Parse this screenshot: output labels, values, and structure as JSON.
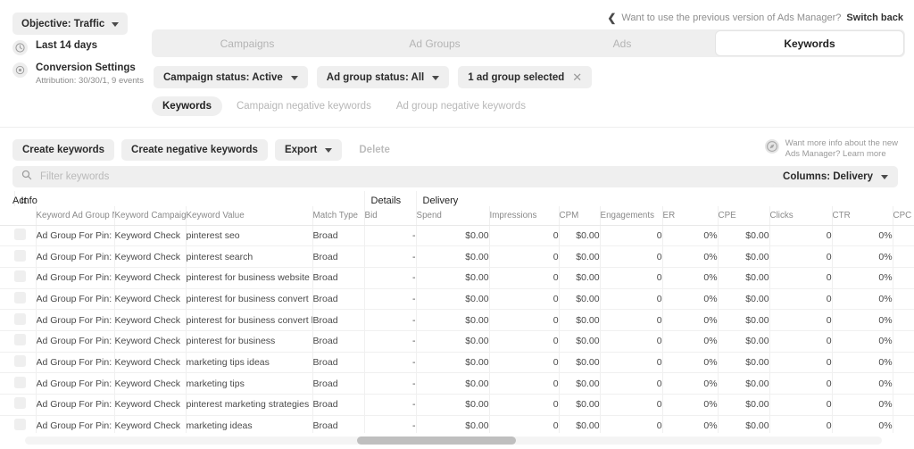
{
  "banner": {
    "back_icon": "chevron-left-icon",
    "text": "Want to use the previous version of Ads Manager?",
    "action": "Switch back"
  },
  "left_rail": {
    "objective": {
      "label": "Objective: Traffic",
      "chevron": "chevron-down-icon"
    },
    "date_range": {
      "icon": "clock-icon",
      "label": "Last 14 days"
    },
    "conversion": {
      "icon": "gear-icon",
      "label": "Conversion Settings",
      "sub": "Attribution: 30/30/1, 9 events"
    }
  },
  "tabs": [
    {
      "label": "Campaigns",
      "active": false
    },
    {
      "label": "Ad Groups",
      "active": false
    },
    {
      "label": "Ads",
      "active": false
    },
    {
      "label": "Keywords",
      "active": true
    }
  ],
  "filters": [
    {
      "label": "Campaign status: Active",
      "type": "dropdown"
    },
    {
      "label": "Ad group status: All",
      "type": "dropdown"
    },
    {
      "label": "1 ad group selected",
      "type": "removable"
    }
  ],
  "subtabs": [
    {
      "label": "Keywords",
      "active": true
    },
    {
      "label": "Campaign negative keywords",
      "active": false
    },
    {
      "label": "Ad group negative keywords",
      "active": false
    }
  ],
  "toolbar": {
    "create_keywords": "Create keywords",
    "create_negative_keywords": "Create negative keywords",
    "export": "Export",
    "delete": "Delete"
  },
  "info_note": {
    "icon": "compass-icon",
    "line1": "Want more info about the new",
    "line2": "Ads Manager? Learn more"
  },
  "search": {
    "icon": "search-icon",
    "placeholder": "Filter keywords",
    "value": ""
  },
  "columns_control": {
    "label": "Columns: Delivery",
    "chevron": "chevron-down-icon"
  },
  "table": {
    "group_headers": [
      {
        "label": "Act",
        "span": 1
      },
      {
        "label": "Info",
        "span": 4
      },
      {
        "label": "Details",
        "span": 1
      },
      {
        "label": "Delivery",
        "span": 9
      }
    ],
    "columns": [
      {
        "key": "checkbox",
        "label": "",
        "align": "left"
      },
      {
        "key": "ad_group",
        "label": "Keyword Ad Group Na",
        "align": "left"
      },
      {
        "key": "campaign",
        "label": "Keyword Campaign Nε",
        "align": "left"
      },
      {
        "key": "keyword",
        "label": "Keyword Value",
        "align": "left"
      },
      {
        "key": "match_type",
        "label": "Match Type",
        "align": "left"
      },
      {
        "key": "bid",
        "label": "Bid",
        "align": "right"
      },
      {
        "key": "spend",
        "label": "Spend",
        "align": "right"
      },
      {
        "key": "impressions",
        "label": "Impressions",
        "align": "right"
      },
      {
        "key": "cpm",
        "label": "CPM",
        "align": "right"
      },
      {
        "key": "engagements",
        "label": "Engagements",
        "align": "right"
      },
      {
        "key": "er",
        "label": "ER",
        "align": "right"
      },
      {
        "key": "cpe",
        "label": "CPE",
        "align": "right"
      },
      {
        "key": "clicks",
        "label": "Clicks",
        "align": "right"
      },
      {
        "key": "ctr",
        "label": "CTR",
        "align": "right"
      },
      {
        "key": "cpc",
        "label": "CPC",
        "align": "right"
      }
    ],
    "rows": [
      {
        "ad_group": "Ad Group For Pin: Pi",
        "campaign": "Keyword Check",
        "keyword": "pinterest seo",
        "match_type": "Broad",
        "bid": "-",
        "spend": "$0.00",
        "impressions": "0",
        "cpm": "$0.00",
        "engagements": "0",
        "er": "0%",
        "cpe": "$0.00",
        "clicks": "0",
        "ctr": "0%",
        "cpc": ""
      },
      {
        "ad_group": "Ad Group For Pin: Pi",
        "campaign": "Keyword Check",
        "keyword": "pinterest search",
        "match_type": "Broad",
        "bid": "-",
        "spend": "$0.00",
        "impressions": "0",
        "cpm": "$0.00",
        "engagements": "0",
        "er": "0%",
        "cpe": "$0.00",
        "clicks": "0",
        "ctr": "0%",
        "cpc": ""
      },
      {
        "ad_group": "Ad Group For Pin: Pi",
        "campaign": "Keyword Check",
        "keyword": "pinterest for business website",
        "match_type": "Broad",
        "bid": "-",
        "spend": "$0.00",
        "impressions": "0",
        "cpm": "$0.00",
        "engagements": "0",
        "er": "0%",
        "cpe": "$0.00",
        "clicks": "0",
        "ctr": "0%",
        "cpc": ""
      },
      {
        "ad_group": "Ad Group For Pin: Pi",
        "campaign": "Keyword Check",
        "keyword": "pinterest for business convert",
        "match_type": "Broad",
        "bid": "-",
        "spend": "$0.00",
        "impressions": "0",
        "cpm": "$0.00",
        "engagements": "0",
        "er": "0%",
        "cpe": "$0.00",
        "clicks": "0",
        "ctr": "0%",
        "cpc": ""
      },
      {
        "ad_group": "Ad Group For Pin: Pi",
        "campaign": "Keyword Check",
        "keyword": "pinterest for business convert how to",
        "match_type": "Broad",
        "bid": "-",
        "spend": "$0.00",
        "impressions": "0",
        "cpm": "$0.00",
        "engagements": "0",
        "er": "0%",
        "cpe": "$0.00",
        "clicks": "0",
        "ctr": "0%",
        "cpc": ""
      },
      {
        "ad_group": "Ad Group For Pin: Pi",
        "campaign": "Keyword Check",
        "keyword": "pinterest for business",
        "match_type": "Broad",
        "bid": "-",
        "spend": "$0.00",
        "impressions": "0",
        "cpm": "$0.00",
        "engagements": "0",
        "er": "0%",
        "cpe": "$0.00",
        "clicks": "0",
        "ctr": "0%",
        "cpc": ""
      },
      {
        "ad_group": "Ad Group For Pin: Pi",
        "campaign": "Keyword Check",
        "keyword": "marketing tips ideas",
        "match_type": "Broad",
        "bid": "-",
        "spend": "$0.00",
        "impressions": "0",
        "cpm": "$0.00",
        "engagements": "0",
        "er": "0%",
        "cpe": "$0.00",
        "clicks": "0",
        "ctr": "0%",
        "cpc": ""
      },
      {
        "ad_group": "Ad Group For Pin: Pi",
        "campaign": "Keyword Check",
        "keyword": "marketing tips",
        "match_type": "Broad",
        "bid": "-",
        "spend": "$0.00",
        "impressions": "0",
        "cpm": "$0.00",
        "engagements": "0",
        "er": "0%",
        "cpe": "$0.00",
        "clicks": "0",
        "ctr": "0%",
        "cpc": ""
      },
      {
        "ad_group": "Ad Group For Pin: Pi",
        "campaign": "Keyword Check",
        "keyword": "pinterest marketing strategies",
        "match_type": "Broad",
        "bid": "-",
        "spend": "$0.00",
        "impressions": "0",
        "cpm": "$0.00",
        "engagements": "0",
        "er": "0%",
        "cpe": "$0.00",
        "clicks": "0",
        "ctr": "0%",
        "cpc": ""
      },
      {
        "ad_group": "Ad Group For Pin: Pi",
        "campaign": "Keyword Check",
        "keyword": "marketing ideas",
        "match_type": "Broad",
        "bid": "-",
        "spend": "$0.00",
        "impressions": "0",
        "cpm": "$0.00",
        "engagements": "0",
        "er": "0%",
        "cpe": "$0.00",
        "clicks": "0",
        "ctr": "0%",
        "cpc": ""
      }
    ]
  },
  "scrollbar": {
    "orientation": "horizontal"
  },
  "colors": {
    "chrome": "#efefef",
    "text": "#2b2b2b",
    "muted": "#8a8a8a",
    "line": "#f0f0f0"
  }
}
